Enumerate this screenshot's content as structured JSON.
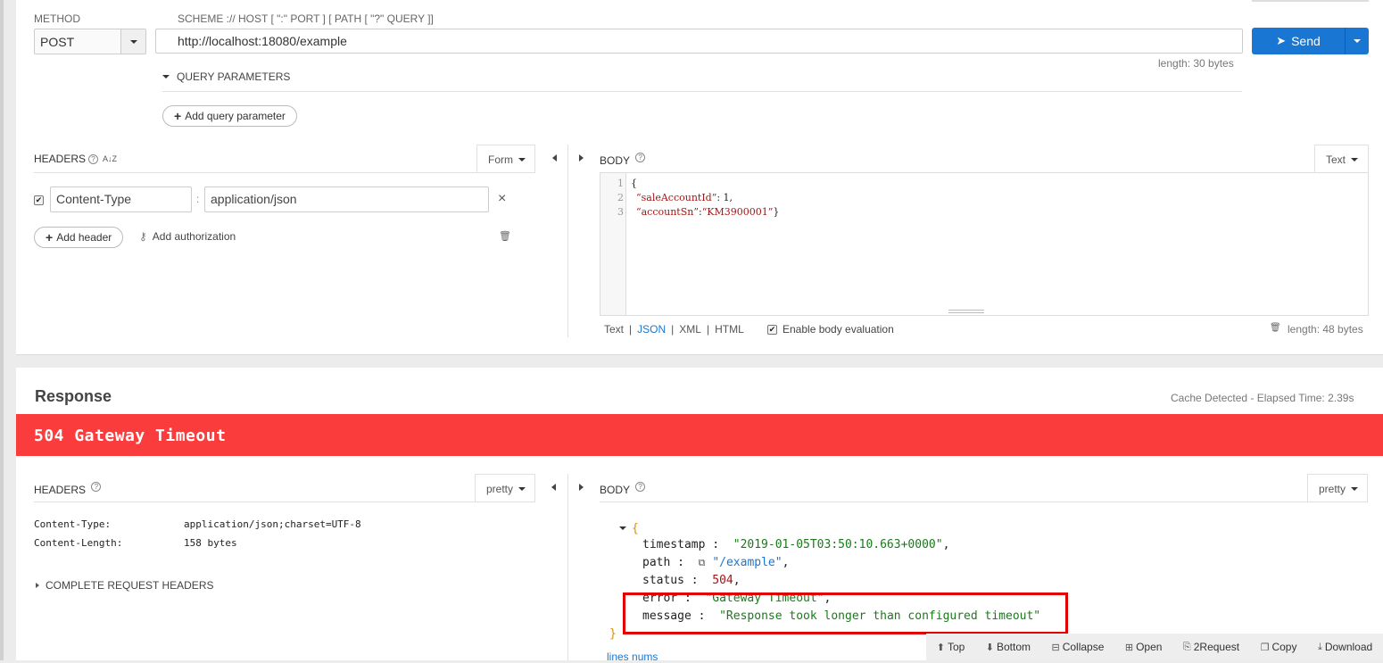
{
  "request": {
    "method_label": "METHOD",
    "method_value": "POST",
    "url_label": "SCHEME :// HOST [ \":\" PORT ] [ PATH [ \"?\" QUERY ]]",
    "url_value": "http://localhost:18080/example",
    "length": "length: 30 bytes",
    "send_label": "Send",
    "query_params_label": "QUERY PARAMETERS",
    "add_query_param_label": "Add query parameter"
  },
  "req_headers": {
    "title": "HEADERS",
    "sort_icon": "A↓Z",
    "form_label": "Form",
    "rows": [
      {
        "name": "Content-Type",
        "value": "application/json",
        "enabled": true
      }
    ],
    "add_header_label": "Add header",
    "add_auth_label": "Add authorization"
  },
  "req_body": {
    "title": "BODY",
    "type_label": "Text",
    "lines": [
      "1",
      "2",
      "3"
    ],
    "code": {
      "l1": "{",
      "l2_key": "“saleAccountId”",
      "l2_rest": ": 1,",
      "l3_key": "“accountSn”",
      "l3_colon": ":",
      "l3_val": "“KM3900001”",
      "l3_end": "}"
    },
    "formats": {
      "text": "Text",
      "json": "JSON",
      "xml": "XML",
      "html": "HTML",
      "sep": "|"
    },
    "enable_eval_label": "Enable body evaluation",
    "length": "length: 48 bytes"
  },
  "response": {
    "title": "Response",
    "elapsed": "Cache Detected - Elapsed Time: 2.39s",
    "status": "504 Gateway Timeout",
    "status_color": "#fb3c3c",
    "headers_title": "HEADERS",
    "headers_format": "pretty",
    "headers": [
      {
        "name": "Content-Type:",
        "value": "application/json;charset=UTF-8"
      },
      {
        "name": "Content-Length:",
        "value": "158 bytes"
      }
    ],
    "complete_headers_label": "COMPLETE REQUEST HEADERS",
    "body_title": "BODY",
    "body_format": "pretty",
    "json": {
      "open": "{",
      "timestamp_key": "timestamp :",
      "timestamp_val": "\"2019-01-05T03:50:10.663+0000\"",
      "path_key": "path :",
      "path_val": "\"/example\"",
      "status_key": "status :",
      "status_val": "504",
      "error_key": "error :",
      "error_val": "\"Gateway Timeout\"",
      "message_key": "message :",
      "message_val": "\"Response took longer than configured timeout\"",
      "close": "}",
      "comma": ","
    },
    "lines_nums_label": "lines nums",
    "toolbar": {
      "top": "Top",
      "bottom": "Bottom",
      "collapse": "Collapse",
      "open": "Open",
      "to_request": "2Request",
      "copy": "Copy",
      "download": "Download"
    }
  },
  "icons": {
    "help": "?",
    "close": "×",
    "trash": "🗑",
    "key": "⚷",
    "external": "⧉",
    "send": "➤"
  }
}
